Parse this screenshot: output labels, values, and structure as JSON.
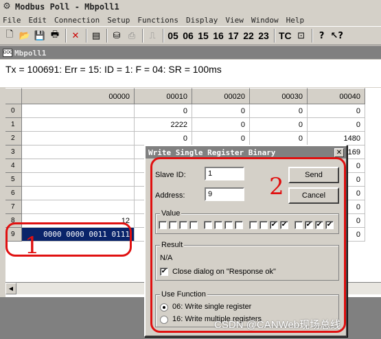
{
  "window": {
    "title": "Modbus Poll - Mbpoll1"
  },
  "menu": [
    "File",
    "Edit",
    "Connection",
    "Setup",
    "Functions",
    "Display",
    "View",
    "Window",
    "Help"
  ],
  "toolbar": {
    "icons": [
      "new-icon",
      "open-icon",
      "save-icon",
      "print-icon",
      "delete-icon",
      "window-icon",
      "read-write-icon",
      "print-preview-icon",
      "pulse-icon"
    ],
    "function_codes": [
      "05",
      "06",
      "15",
      "16",
      "17",
      "22",
      "23"
    ],
    "tc_label": "TC",
    "help_icons": [
      "monitor-icon",
      "help-icon",
      "context-help-icon"
    ]
  },
  "child_window": {
    "title": "Mbpoll1",
    "icon_text": "DOC"
  },
  "status_line": "Tx = 100691: Err = 15: ID = 1: F = 04: SR = 100ms",
  "grid": {
    "columns": [
      "00000",
      "00010",
      "00020",
      "00030",
      "00040"
    ],
    "rows": [
      {
        "index": "0",
        "cells": [
          "",
          "0",
          "0",
          "0",
          "0"
        ]
      },
      {
        "index": "1",
        "cells": [
          "",
          "2222",
          "0",
          "0",
          "0"
        ]
      },
      {
        "index": "2",
        "cells": [
          "",
          "0",
          "0",
          "0",
          "1480"
        ]
      },
      {
        "index": "3",
        "cells": [
          "",
          "",
          "",
          "",
          "169"
        ]
      },
      {
        "index": "4",
        "cells": [
          "",
          "",
          "",
          "",
          "0"
        ]
      },
      {
        "index": "5",
        "cells": [
          "",
          "",
          "",
          "",
          "0"
        ]
      },
      {
        "index": "6",
        "cells": [
          "",
          "",
          "",
          "",
          "0"
        ]
      },
      {
        "index": "7",
        "cells": [
          "",
          "",
          "",
          "",
          "0"
        ]
      },
      {
        "index": "8",
        "cells": [
          "12",
          "",
          "",
          "",
          "0"
        ]
      },
      {
        "index": "9",
        "cells": [
          "0000 0000 0011 0111",
          "",
          "",
          "",
          "0"
        ]
      }
    ]
  },
  "dialog": {
    "title": "Write Single Register Binary",
    "slave_id_label": "Slave ID:",
    "slave_id_value": "1",
    "address_label": "Address:",
    "address_value": "9",
    "send_label": "Send",
    "cancel_label": "Cancel",
    "value_group_label": "Value",
    "value_bits": [
      0,
      0,
      0,
      0,
      0,
      0,
      0,
      0,
      0,
      0,
      1,
      1,
      0,
      1,
      1,
      1
    ],
    "result_group_label": "Result",
    "result_text": "N/A",
    "close_on_ok_label": "Close dialog on \"Response ok\"",
    "close_on_ok_checked": true,
    "use_function_group_label": "Use Function",
    "func_06_label": "06: Write single register",
    "func_16_label": "16: Write multiple registers",
    "selected_function": "06"
  },
  "annotations": {
    "one": "1",
    "two": "2",
    "color": "#e01010"
  },
  "watermark": "CSDN @CANWeb现场总线"
}
